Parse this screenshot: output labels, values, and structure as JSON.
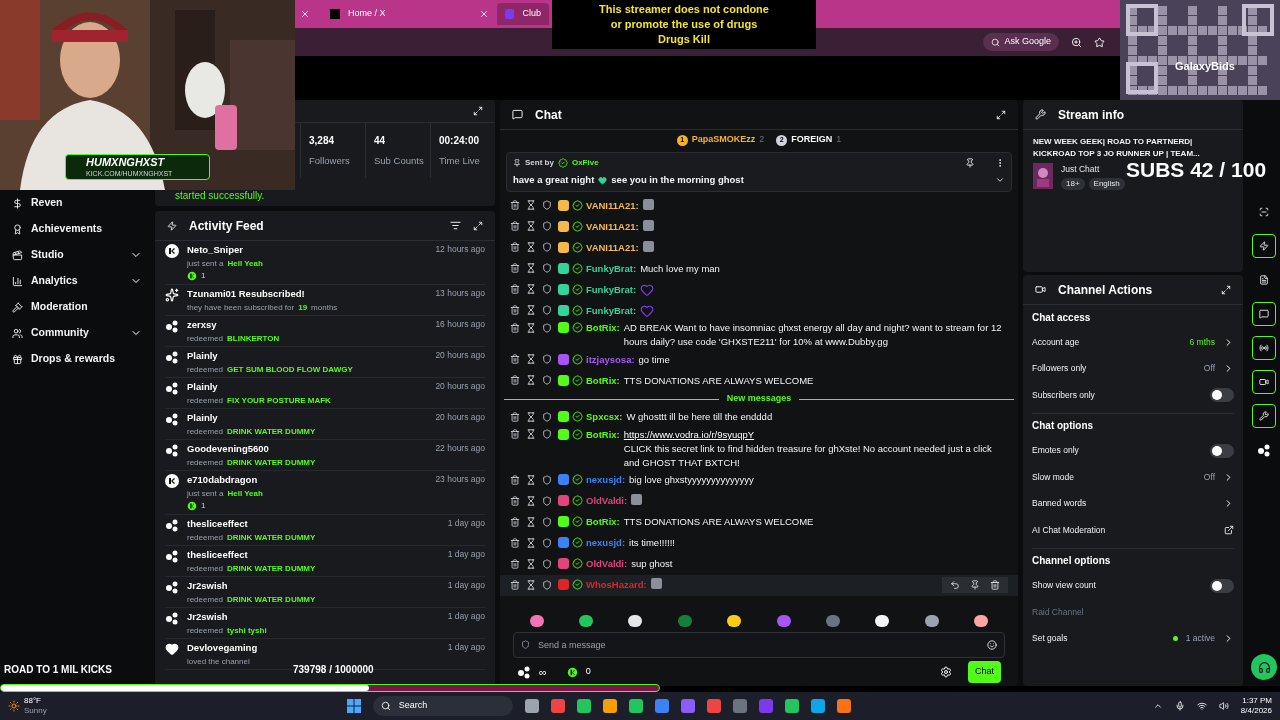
{
  "browser": {
    "tabs": [
      {
        "label": "Home / X",
        "selected": false
      },
      {
        "label": "Club",
        "selected": true
      }
    ],
    "ask_button": "Ask Google"
  },
  "overlay": {
    "banner": [
      "This streamer does not condone",
      "or promote the use of drugs",
      "Drugs Kill"
    ],
    "logo": "HUMXNGHXST",
    "logo_sub": "KICK.COM/HUMXNGHXST",
    "sponsor": "GalaxyBids",
    "subs_goal": "SUBS 42 / 100",
    "road_title": "ROAD TO 1 MIL KICKS",
    "road_count": "739798 / 1000000",
    "road": {
      "level": 0.56
    }
  },
  "sidebar": {
    "items": [
      {
        "label": "Reven",
        "expandable": false
      },
      {
        "label": "Achievements",
        "expandable": false
      },
      {
        "label": "Studio",
        "expandable": true
      },
      {
        "label": "Analytics",
        "expandable": true
      },
      {
        "label": "Moderation",
        "expandable": false
      },
      {
        "label": "Community",
        "expandable": true
      },
      {
        "label": "Drops & rewards",
        "expandable": false
      }
    ]
  },
  "stats": {
    "items": [
      {
        "value": "3,284",
        "label": "Followers"
      },
      {
        "value": "44",
        "label": "Sub Counts"
      },
      {
        "value": "00:24:00",
        "label": "Time Live"
      }
    ],
    "notice": "started successfully."
  },
  "activity": {
    "title": "Activity Feed",
    "items": [
      {
        "kind": "gift",
        "user": "Neto_Sniper",
        "time": "12 hours ago",
        "detail": [
          {
            "text": "just sent a",
            "highlight": false
          },
          {
            "text": "Hell Yeah",
            "highlight": true
          }
        ],
        "count": "1"
      },
      {
        "kind": "resub",
        "user": "Tzunami01 Resubscribed!",
        "time": "13 hours ago",
        "detail": [
          {
            "text": "they have been subscribed for",
            "highlight": false
          },
          {
            "text": "19",
            "highlight": true
          },
          {
            "text": "months",
            "highlight": false
          }
        ]
      },
      {
        "kind": "redeem",
        "user": "zerxsy",
        "time": "16 hours ago",
        "detail": [
          {
            "text": "redeemed",
            "highlight": false
          },
          {
            "text": "BLINKERTON",
            "highlight": true
          }
        ]
      },
      {
        "kind": "redeem",
        "user": "Plainly",
        "time": "20 hours ago",
        "detail": [
          {
            "text": "redeemed",
            "highlight": false
          },
          {
            "text": "GET SUM BLOOD FLOW DAWGY",
            "highlight": true
          }
        ]
      },
      {
        "kind": "redeem",
        "user": "Plainly",
        "time": "20 hours ago",
        "detail": [
          {
            "text": "redeemed",
            "highlight": false
          },
          {
            "text": "FIX YOUR POSTURE MAFK",
            "highlight": true
          }
        ]
      },
      {
        "kind": "redeem",
        "user": "Plainly",
        "time": "20 hours ago",
        "detail": [
          {
            "text": "redeemed",
            "highlight": false
          },
          {
            "text": "DRINK WATER DUMMY",
            "highlight": true
          }
        ]
      },
      {
        "kind": "redeem",
        "user": "Goodevening5600",
        "time": "22 hours ago",
        "detail": [
          {
            "text": "redeemed",
            "highlight": false
          },
          {
            "text": "DRINK WATER DUMMY",
            "highlight": true
          }
        ]
      },
      {
        "kind": "gift",
        "user": "e710dabdragon",
        "time": "23 hours ago",
        "detail": [
          {
            "text": "just sent a",
            "highlight": false
          },
          {
            "text": "Hell Yeah",
            "highlight": true
          }
        ],
        "count": "1"
      },
      {
        "kind": "redeem",
        "user": "thesliceeffect",
        "time": "1 day ago",
        "detail": [
          {
            "text": "redeemed",
            "highlight": false
          },
          {
            "text": "DRINK WATER DUMMY",
            "highlight": true
          }
        ]
      },
      {
        "kind": "redeem",
        "user": "thesliceeffect",
        "time": "1 day ago",
        "detail": [
          {
            "text": "redeemed",
            "highlight": false
          },
          {
            "text": "DRINK WATER DUMMY",
            "highlight": true
          }
        ]
      },
      {
        "kind": "redeem",
        "user": "Jr2swish",
        "time": "1 day ago",
        "detail": [
          {
            "text": "redeemed",
            "highlight": false
          },
          {
            "text": "DRINK WATER DUMMY",
            "highlight": true
          }
        ]
      },
      {
        "kind": "redeem",
        "user": "Jr2swish",
        "time": "1 day ago",
        "detail": [
          {
            "text": "redeemed",
            "highlight": false
          },
          {
            "text": "tyshi tyshi",
            "highlight": true
          }
        ]
      },
      {
        "kind": "follow",
        "user": "Devlovegaming",
        "time": "1 day ago",
        "detail": [
          {
            "text": "loved the channel",
            "highlight": false
          }
        ]
      }
    ]
  },
  "chat": {
    "title": "Chat",
    "leaders": [
      {
        "rank": "1",
        "name": "PapaSMOKEzz",
        "count": "2",
        "color": "#f5b324"
      },
      {
        "rank": "2",
        "name": "FOREIGN",
        "count": "1",
        "color": "#d1d5db"
      }
    ],
    "pinned": {
      "label": "Sent by",
      "user": "OxFive",
      "before": "have a great night",
      "after": "see you in the morning ghost"
    },
    "messages": [
      {
        "kind": "emote",
        "user": "VANI11A21:",
        "color": "#f5b94b",
        "hovered": false
      },
      {
        "kind": "emote",
        "user": "VANI11A21:",
        "color": "#f5b94b",
        "hovered": false
      },
      {
        "kind": "emote",
        "user": "VANI11A21:",
        "color": "#f5b94b",
        "hovered": false
      },
      {
        "kind": "text",
        "user": "FunkyBrat:",
        "color": "#34d399",
        "text": "Much love my man",
        "hovered": false
      },
      {
        "kind": "heart",
        "user": "FunkyBrat:",
        "color": "#34d399",
        "hovered": false
      },
      {
        "kind": "heart",
        "user": "FunkyBrat:",
        "color": "#34d399",
        "hovered": false
      },
      {
        "kind": "text",
        "user": "BotRix:",
        "color": "#53fc18",
        "text": "AD BREAK Want to have insomniac ghxst energy all day and night? want to stream for 12 hours daily? use code 'GHXSTE211' for 10% at www.Dubby.gg",
        "hovered": false
      },
      {
        "kind": "text",
        "user": "itzjaysosa:",
        "color": "#a855f7",
        "text": "go time",
        "hovered": false
      },
      {
        "kind": "text",
        "user": "BotRix:",
        "color": "#53fc18",
        "text": "TTS DONATIONS ARE ALWAYS WELCOME",
        "hovered": false
      },
      {
        "kind": "divider",
        "text": "New messages"
      },
      {
        "kind": "text",
        "user": "Spxcsx:",
        "color": "#53fc18",
        "text": "W ghosttt ill be here till the endddd",
        "hovered": false
      },
      {
        "kind": "link",
        "user": "BotRix:",
        "color": "#53fc18",
        "link": "https://www.vodra.io/r/9syuqpY",
        "text": "CLICK this secret link to find hidden treasure for ghXste! No account needed just a click and GHOST THAT BXTCH!",
        "hovered": false
      },
      {
        "kind": "text",
        "user": "nexusjd:",
        "color": "#3b82f6",
        "text": "big love ghxstyyyyyyyyyyyyyy",
        "hovered": false
      },
      {
        "kind": "emote",
        "user": "OldValdi:",
        "color": "#e0457b",
        "hovered": false
      },
      {
        "kind": "text",
        "user": "BotRix:",
        "color": "#53fc18",
        "text": "TTS DONATIONS ARE ALWAYS WELCOME",
        "hovered": false
      },
      {
        "kind": "text",
        "user": "nexusjd:",
        "color": "#3b82f6",
        "text": "its time!!!!!!",
        "hovered": false
      },
      {
        "kind": "text",
        "user": "OldValdi:",
        "color": "#e0457b",
        "text": "sup ghost",
        "hovered": false
      },
      {
        "kind": "emote",
        "user": "WhosHazard:",
        "color": "#dc2626",
        "hovered": true
      }
    ],
    "placeholder": "Send a message",
    "points": "∞",
    "kicks": "0",
    "send": "Chat"
  },
  "stream_info": {
    "title": "Stream info",
    "stream_title": "NEW WEEK GEEK| ROAD TO PARTNERD| KICKROAD TOP 3 JO RUNNER UP | TEAM...",
    "category": "Just Chatt",
    "tags": [
      "18+",
      "English"
    ]
  },
  "channel_actions": {
    "title": "Channel Actions",
    "sections": [
      {
        "title": "Chat access",
        "rows": [
          {
            "kind": "value",
            "label": "Account age",
            "value": "6 mths",
            "accent": true
          },
          {
            "kind": "value",
            "label": "Followers only",
            "value": "Off",
            "accent": false
          },
          {
            "kind": "toggle",
            "label": "Subscribers only",
            "on": false
          }
        ]
      },
      {
        "title": "Chat options",
        "rows": [
          {
            "kind": "toggle",
            "label": "Emotes only",
            "on": false
          },
          {
            "kind": "value",
            "label": "Slow mode",
            "value": "Off",
            "accent": false
          },
          {
            "kind": "link",
            "label": "Banned words"
          },
          {
            "kind": "external",
            "label": "AI Chat Moderation"
          }
        ]
      },
      {
        "title": "Channel options",
        "rows": [
          {
            "kind": "toggle",
            "label": "Show view count",
            "on": false
          },
          {
            "kind": "disabled",
            "label": "Raid Channel"
          },
          {
            "kind": "goal",
            "label": "Set goals",
            "value": "1 active"
          }
        ]
      }
    ]
  },
  "rail": [
    {
      "highlighted": false
    },
    {
      "highlighted": true
    },
    {
      "highlighted": false
    },
    {
      "highlighted": true
    },
    {
      "highlighted": true
    },
    {
      "highlighted": true
    },
    {
      "highlighted": true
    },
    {
      "highlighted": false
    }
  ],
  "taskbar": {
    "weather": "88°F",
    "condition": "Sunny",
    "search": "Search",
    "time": "1:37 PM",
    "date": "8/4/2026"
  }
}
